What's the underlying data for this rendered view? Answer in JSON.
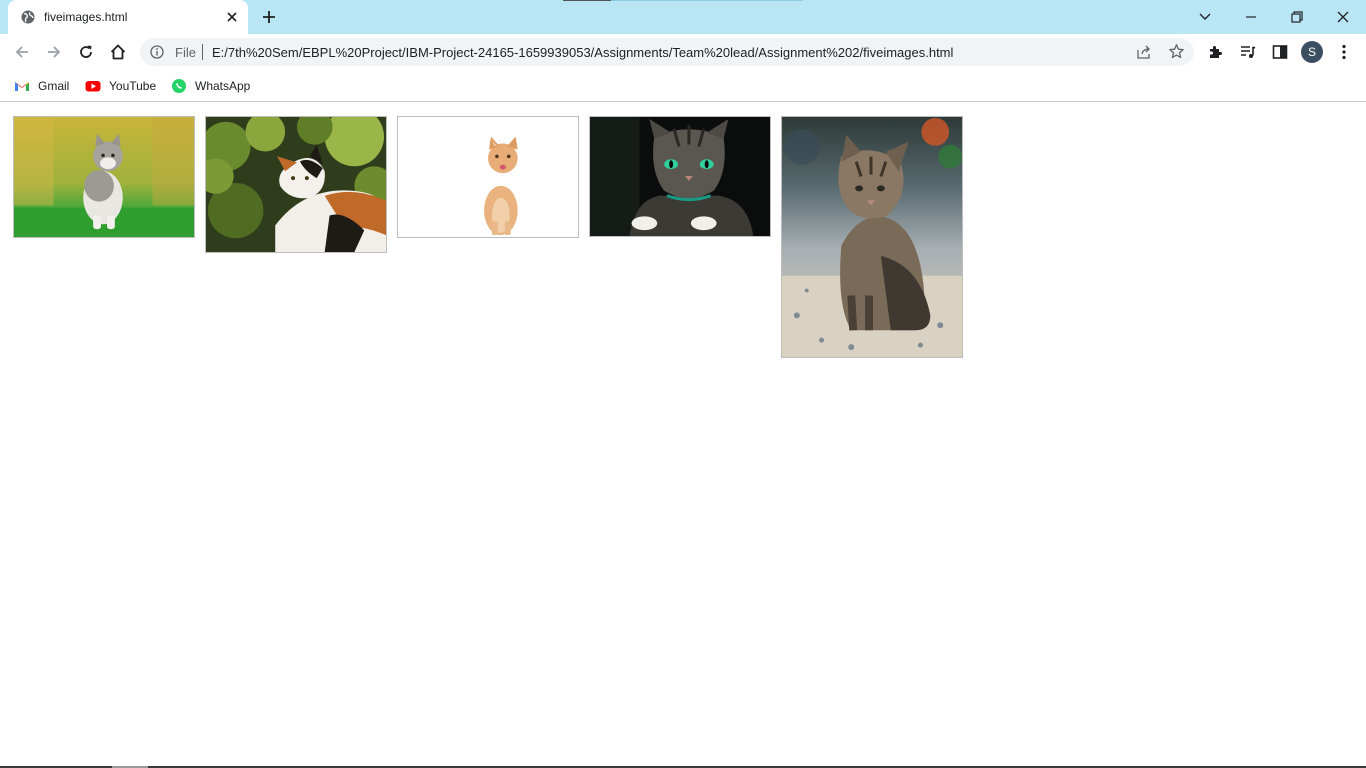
{
  "tab": {
    "title": "fiveimages.html",
    "favicon": "globe-icon"
  },
  "toolbar": {
    "omnibox_scheme_label": "File",
    "url": "E:/7th%20Sem/EBPL%20Project/IBM-Project-24165-1659939053/Assignments/Team%20lead/Assignment%202/fiveimages.html",
    "avatar_letter": "S"
  },
  "bookmarks": [
    {
      "label": "Gmail",
      "icon": "gmail-icon"
    },
    {
      "label": "YouTube",
      "icon": "youtube-icon"
    },
    {
      "label": "WhatsApp",
      "icon": "whatsapp-icon"
    }
  ],
  "images": [
    {
      "subject": "grey and white kitten sitting on grass"
    },
    {
      "subject": "calico cat among green leaves"
    },
    {
      "subject": "ginger kitten on white background"
    },
    {
      "subject": "tabby cat with green eyes on dark background"
    },
    {
      "subject": "tabby kitten sitting on stone floor"
    }
  ],
  "colors": {
    "titlebar": "#b9e6f4",
    "omnibox": "#f1f3f4",
    "avatar": "#3c4f60"
  }
}
